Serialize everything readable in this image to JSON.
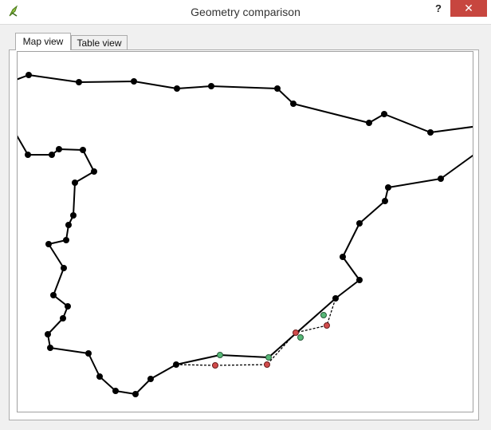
{
  "window": {
    "title": "Geometry comparison",
    "help_label": "?",
    "close_label": "✕",
    "app_icon": "qgis-icon"
  },
  "tabs": [
    {
      "label": "Map view",
      "selected": true
    },
    {
      "label": "Table view",
      "selected": false
    }
  ],
  "map": {
    "colors": {
      "line": "#000000",
      "vertex": "#000000",
      "original_vertex": "#57b877",
      "modified_vertex": "#d24b4b"
    }
  }
}
